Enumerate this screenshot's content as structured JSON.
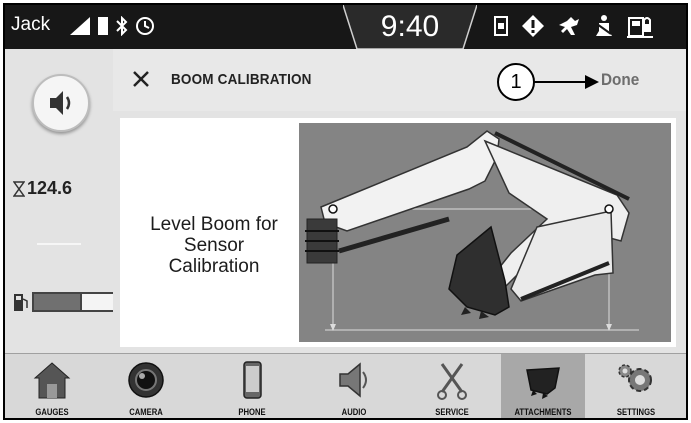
{
  "status_bar": {
    "user": "Jack",
    "time": "9:40",
    "left_icons": [
      "signal-icon",
      "battery-icon",
      "bluetooth-icon",
      "clock-icon"
    ],
    "right_icons": [
      "phone-indicator-icon",
      "warning-icon",
      "dog-icon",
      "seat-belt-icon",
      "fuel-lock-icon"
    ]
  },
  "sidebar": {
    "volume_icon": "speaker-icon",
    "hours_icon": "hourglass-icon",
    "hours": "124.6",
    "fuel_icon": "fuel-pump-icon",
    "fuel_level": 0.58
  },
  "header": {
    "close_icon": "close-icon",
    "title": "BOOM CALIBRATION",
    "callout": "1",
    "done_label": "Done"
  },
  "content": {
    "instruction": "Level Boom for Sensor Calibration",
    "illustration": "excavator-boom-level-illustration"
  },
  "nav": {
    "items": [
      {
        "label": "GAUGES",
        "icon": "house-icon"
      },
      {
        "label": "CAMERA",
        "icon": "camera-lens-icon"
      },
      {
        "label": "PHONE",
        "icon": "smartphone-icon"
      },
      {
        "label": "AUDIO",
        "icon": "speaker-icon"
      },
      {
        "label": "SERVICE",
        "icon": "wrench-tools-icon"
      },
      {
        "label": "ATTACHMENTS",
        "icon": "bucket-icon"
      },
      {
        "label": "SETTINGS",
        "icon": "gear-icon"
      }
    ],
    "active": "ATTACHMENTS"
  },
  "colors": {
    "status_bar": "#171717",
    "panel_background": "#e3e3e3",
    "illustration_background": "#848484",
    "active_tab": "#a8a8a8"
  }
}
